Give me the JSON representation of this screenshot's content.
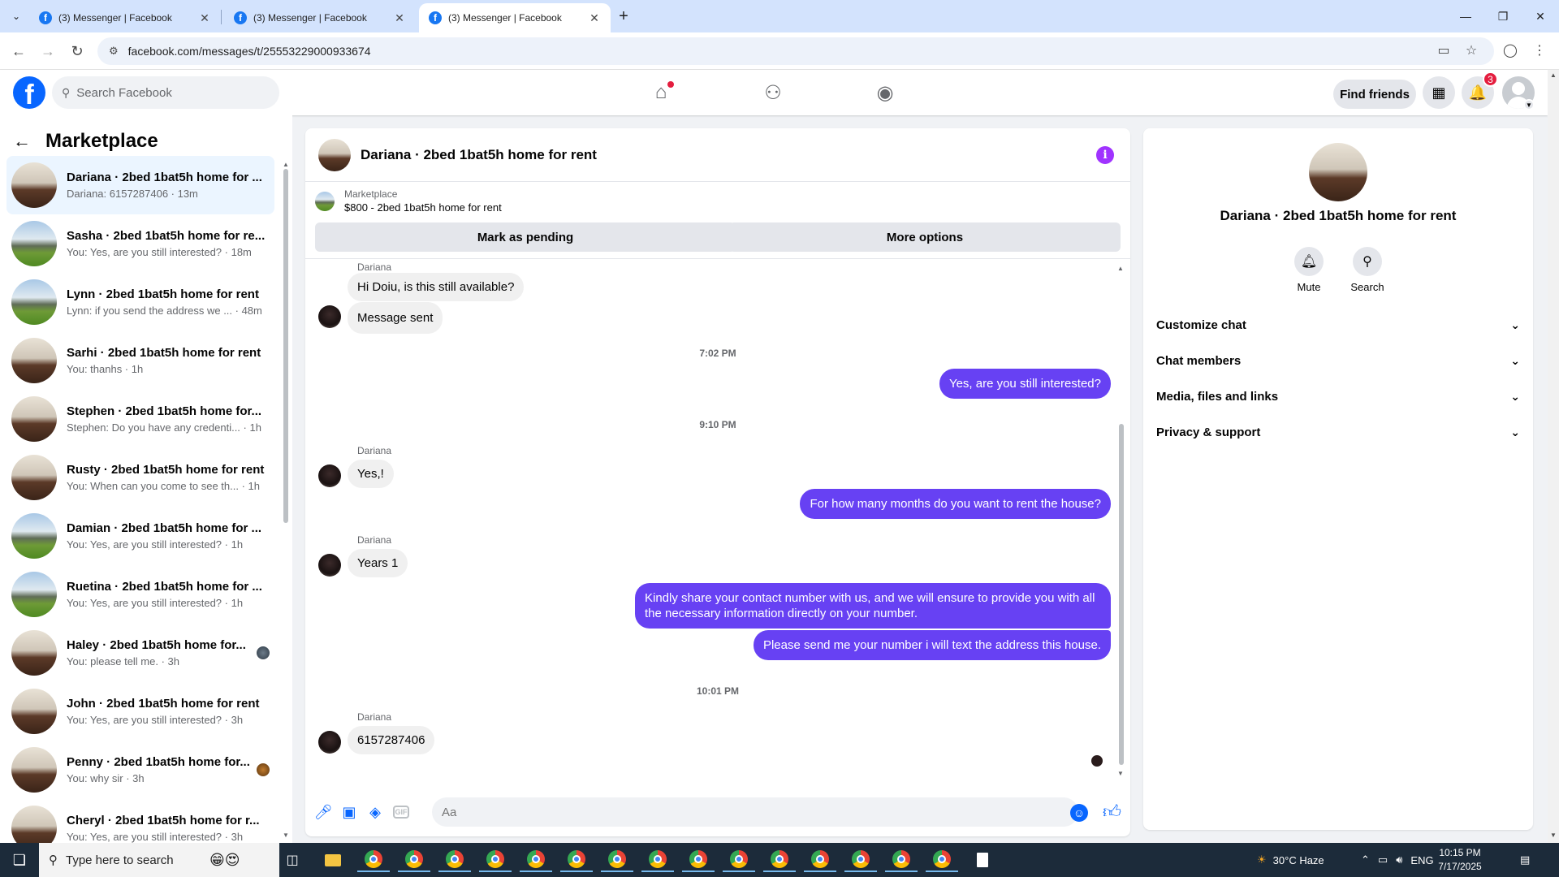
{
  "browser": {
    "tabs": [
      {
        "title": "(3) Messenger | Facebook"
      },
      {
        "title": "(3) Messenger | Facebook"
      },
      {
        "title": "(3) Messenger | Facebook"
      }
    ],
    "url": "facebook.com/messages/t/25553229000933674"
  },
  "fb_header": {
    "search_placeholder": "Search Facebook",
    "find_friends": "Find friends",
    "notification_count": "3"
  },
  "sidebar": {
    "title": "Marketplace",
    "conversations": [
      {
        "name": "Dariana · 2bed 1bat5h home for ...",
        "snippet": "Dariana: 6157287406 · 13m",
        "thumb": "room"
      },
      {
        "name": "Sasha · 2bed 1bat5h home for re...",
        "snippet": "You: Yes, are you still interested? · 18m",
        "thumb": "house"
      },
      {
        "name": "Lynn · 2bed 1bat5h home for rent",
        "snippet": "Lynn: if you send the address we ... · 48m",
        "thumb": "house"
      },
      {
        "name": "Sarhi · 2bed 1bat5h home for rent",
        "snippet": "You: thanhs · 1h",
        "thumb": "room"
      },
      {
        "name": "Stephen · 2bed 1bat5h home for...",
        "snippet": "Stephen: Do you have any credenti... · 1h",
        "thumb": "room"
      },
      {
        "name": "Rusty · 2bed 1bat5h home for rent",
        "snippet": "You: When can you come to see th... · 1h",
        "thumb": "room"
      },
      {
        "name": "Damian · 2bed 1bat5h home for ...",
        "snippet": "You: Yes, are you still interested? · 1h",
        "thumb": "house"
      },
      {
        "name": "Ruetina · 2bed 1bat5h home for ...",
        "snippet": "You: Yes, are you still interested? · 1h",
        "thumb": "house"
      },
      {
        "name": "Haley · 2bed 1bat5h home for...",
        "snippet": "You: please tell me. · 3h",
        "thumb": "room"
      },
      {
        "name": "John · 2bed 1bat5h home for rent",
        "snippet": "You: Yes, are you still interested? · 3h",
        "thumb": "room"
      },
      {
        "name": "Penny · 2bed 1bat5h home for...",
        "snippet": "You: why sir · 3h",
        "thumb": "room"
      },
      {
        "name": "Cheryl · 2bed 1bat5h home for r...",
        "snippet": "You: Yes, are you still interested? · 3h",
        "thumb": "room"
      }
    ]
  },
  "chat": {
    "title": "Dariana · 2bed 1bat5h home for rent",
    "marketplace_label": "Marketplace",
    "listing": "$800 - 2bed 1bat5h home for rent",
    "mark_pending": "Mark as pending",
    "more_options": "More options",
    "messages": {
      "sender": "Dariana",
      "m1": "Hi Doiu, is this still available?",
      "m2": "Message sent",
      "t1": "7:02 PM",
      "m3": "Yes, are you still interested?",
      "t2": "9:10 PM",
      "m4": "Yes,!",
      "m5": "For how many months do you want to rent the house?",
      "m6": "Years 1",
      "m7": "Kindly share your contact number with us, and we will ensure to provide you with all the necessary information directly on your number.",
      "m8": "Please send me your number i will text the address this house.",
      "t3": "10:01 PM",
      "m9": "6157287406"
    },
    "composer_placeholder": "Aa"
  },
  "details": {
    "name": "Dariana · 2bed 1bat5h home for rent",
    "mute": "Mute",
    "search": "Search",
    "sections": [
      "Customize chat",
      "Chat members",
      "Media, files and links",
      "Privacy & support"
    ]
  },
  "taskbar": {
    "search_placeholder": "Type here to search",
    "weather": "30°C  Haze",
    "language": "ENG",
    "time": "10:15 PM",
    "date": "7/17/2025"
  },
  "colors": {
    "facebook_blue": "#0866ff",
    "outgoing_bubble": "#6741f3",
    "active_conversation": "#ebf5ff",
    "badge_red": "#e41e3f"
  }
}
